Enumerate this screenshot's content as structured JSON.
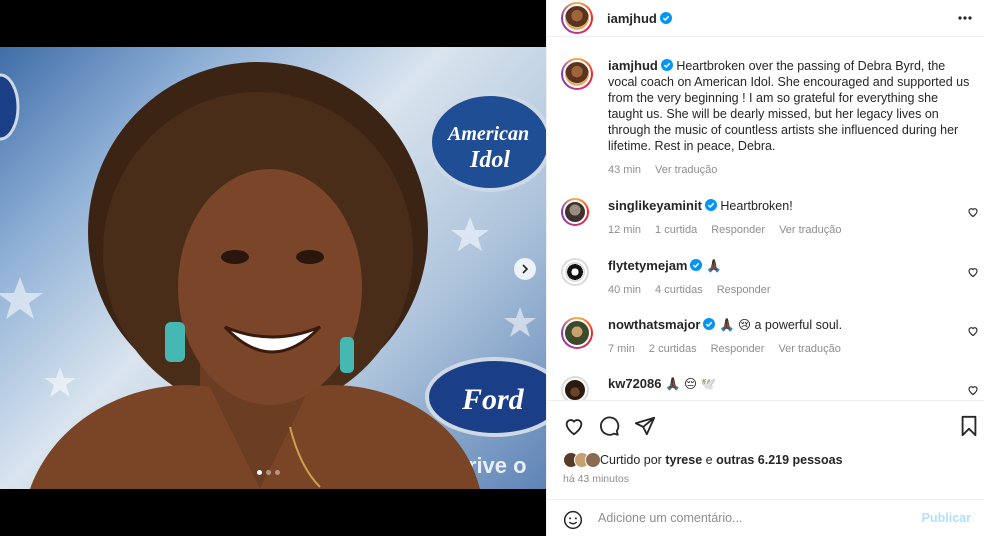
{
  "post": {
    "author": "iamjhud",
    "caption": "Heartbroken over the passing of Debra Byrd, the vocal coach on American Idol. She encouraged and supported us from the very beginning ! I am so grateful for everything she taught us. She will be dearly missed, but her legacy lives on through the music of countless artists she influenced during her lifetime. Rest in peace, Debra.",
    "caption_time": "43 min",
    "see_translation": "Ver tradução",
    "carousel": {
      "current": 1,
      "total": 3
    },
    "photo_logos": [
      "American",
      "Idol",
      "Ford",
      "Drive o"
    ]
  },
  "comments": [
    {
      "user": "singlikeyaminit",
      "verified": true,
      "text": "Heartbroken!",
      "time": "12 min",
      "likes": "1 curtida",
      "reply": "Responder",
      "translate": "Ver tradução"
    },
    {
      "user": "flytetymejam",
      "verified": true,
      "text": "🙏🏿",
      "time": "40 min",
      "likes": "4 curtidas",
      "reply": "Responder",
      "translate": ""
    },
    {
      "user": "nowthatsmajor",
      "verified": true,
      "text": "🙏🏿 😢 a powerful soul.",
      "time": "7 min",
      "likes": "2 curtidas",
      "reply": "Responder",
      "translate": "Ver tradução"
    },
    {
      "user": "kw72086",
      "verified": false,
      "text": "🙏🏿 😔 🕊️",
      "time": "",
      "likes": "",
      "reply": "",
      "translate": ""
    }
  ],
  "likes": {
    "prefix": "Curtido por",
    "user": "tyrese",
    "middle": "e",
    "others": "outras 6.219 pessoas"
  },
  "time_ago": "há 43 minutos",
  "composer": {
    "placeholder": "Adicione um comentário...",
    "publish": "Publicar"
  },
  "icons": {
    "more": "more-horizontal-icon",
    "heart": "heart-icon",
    "comment": "comment-icon",
    "share": "share-icon",
    "save": "bookmark-icon",
    "emoji": "emoji-icon",
    "next": "chevron-right-icon",
    "verified": "verified-badge-icon"
  },
  "colors": {
    "verified": "#0095f6",
    "publish_disabled": "#b2dffc",
    "meta_text": "#8e8e8e"
  }
}
